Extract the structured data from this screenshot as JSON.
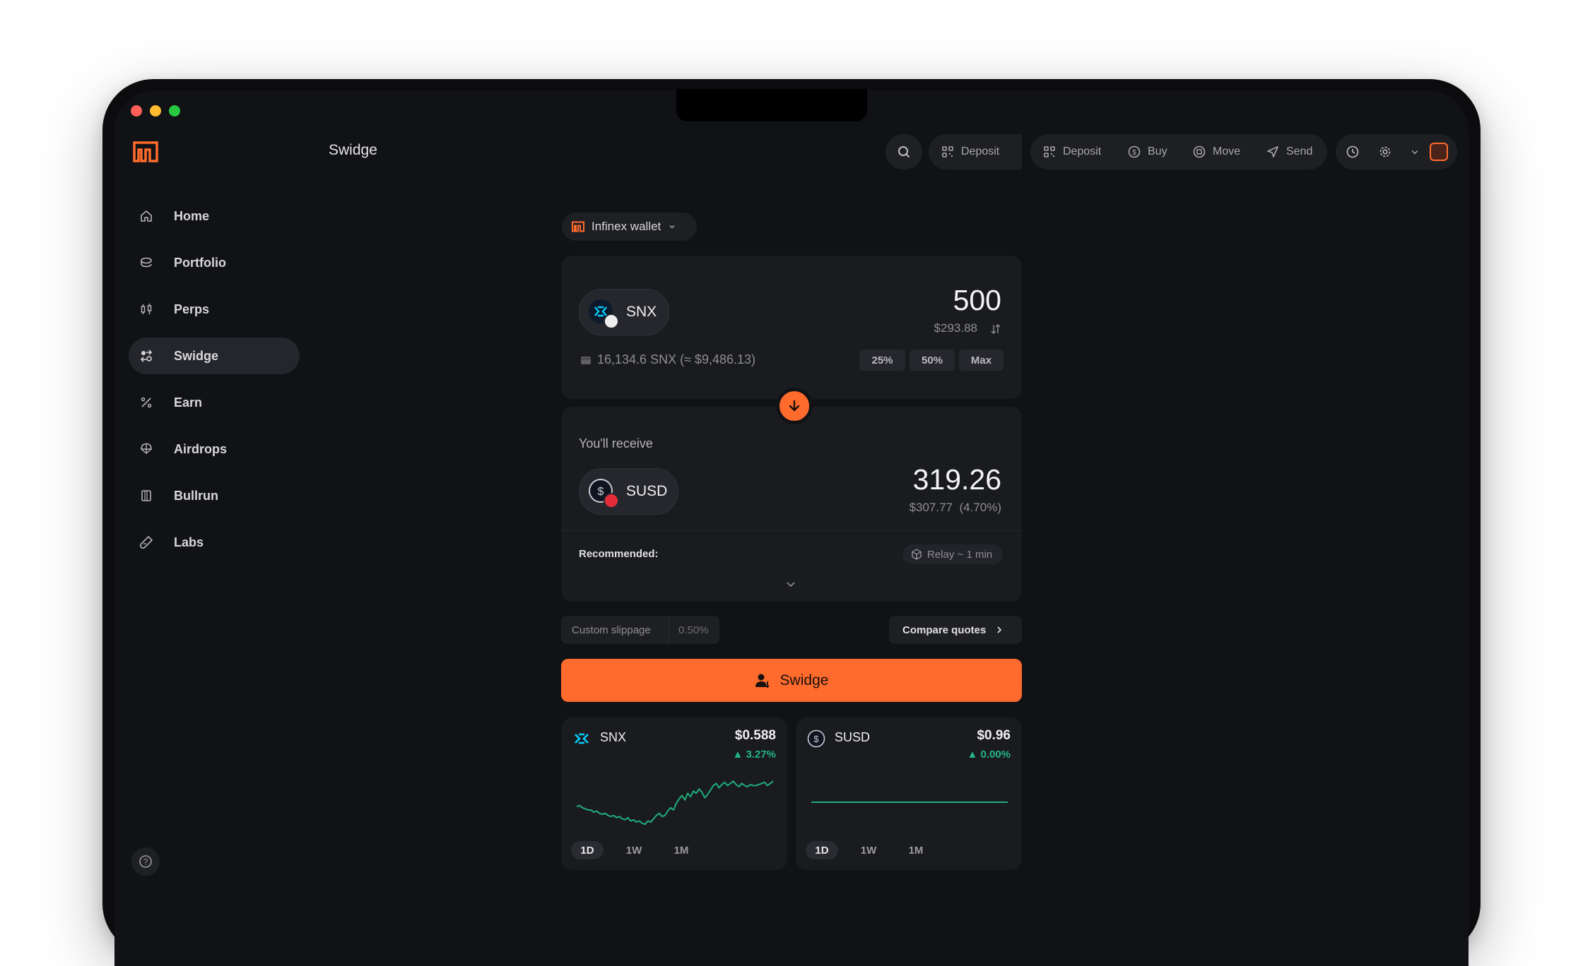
{
  "app": {
    "page_title": "Swidge",
    "brand_color": "#ff6b2c",
    "traffic_lights": [
      "#ff5f57",
      "#febc2e",
      "#28c840"
    ]
  },
  "toolbar": {
    "search_icon": "search-icon",
    "deposit_label_1": "Deposit",
    "deposit_label_2": "Deposit",
    "buy_label": "Buy",
    "move_label": "Move",
    "send_label": "Send"
  },
  "sidebar": {
    "items": [
      {
        "label": "Home",
        "icon": "home-icon"
      },
      {
        "label": "Portfolio",
        "icon": "coins-icon"
      },
      {
        "label": "Perps",
        "icon": "candles-icon"
      },
      {
        "label": "Swidge",
        "icon": "swidge-icon",
        "active": true
      },
      {
        "label": "Earn",
        "icon": "percent-icon"
      },
      {
        "label": "Airdrops",
        "icon": "parachute-icon"
      },
      {
        "label": "Bullrun",
        "icon": "book-icon"
      },
      {
        "label": "Labs",
        "icon": "flask-icon"
      }
    ]
  },
  "swap": {
    "wallet_label": "Infinex wallet",
    "from": {
      "symbol": "SNX",
      "amount": "500",
      "usd": "$293.88",
      "balance": "16,134.6 SNX (≈ $9,486.13)",
      "pct_buttons": [
        "25%",
        "50%",
        "Max"
      ]
    },
    "to": {
      "heading": "You'll receive",
      "symbol": "SUSD",
      "amount": "319.26",
      "usd": "$307.77",
      "pct": "(4.70%)"
    },
    "recommended_label": "Recommended:",
    "route": "Relay ~ 1 min",
    "slippage_label": "Custom slippage",
    "slippage_value": "0.50%",
    "compare_label": "Compare quotes",
    "cta_label": "Swidge"
  },
  "prices": [
    {
      "symbol": "SNX",
      "price": "$0.588",
      "change": "▲ 3.27%",
      "ranges": [
        "1D",
        "1W",
        "1M"
      ],
      "active_range": "1D"
    },
    {
      "symbol": "SUSD",
      "price": "$0.96",
      "change": "▲ 0.00%",
      "ranges": [
        "1D",
        "1W",
        "1M"
      ],
      "active_range": "1D"
    }
  ],
  "chart_data": [
    {
      "type": "line",
      "title": "SNX",
      "values": [
        0.569,
        0.57,
        0.568,
        0.567,
        0.566,
        0.566,
        0.564,
        0.565,
        0.563,
        0.562,
        0.563,
        0.561,
        0.56,
        0.561,
        0.559,
        0.56,
        0.558,
        0.557,
        0.559,
        0.556,
        0.557,
        0.555,
        0.556,
        0.554,
        0.553,
        0.556,
        0.555,
        0.558,
        0.561,
        0.563,
        0.56,
        0.561,
        0.565,
        0.568,
        0.566,
        0.572,
        0.576,
        0.579,
        0.575,
        0.581,
        0.578,
        0.583,
        0.581,
        0.585,
        0.582,
        0.577,
        0.58,
        0.584,
        0.588,
        0.59,
        0.586,
        0.589,
        0.591,
        0.588,
        0.59,
        0.592,
        0.589,
        0.587,
        0.59,
        0.588,
        0.587,
        0.589,
        0.588,
        0.588,
        0.589,
        0.59,
        0.591,
        0.588,
        0.59,
        0.592
      ],
      "color": "#1fae7a"
    },
    {
      "type": "line",
      "title": "SUSD",
      "values": [
        0.96,
        0.96,
        0.96,
        0.96,
        0.96,
        0.96,
        0.96,
        0.96,
        0.96,
        0.96,
        0.96,
        0.96
      ],
      "color": "#1fae7a"
    }
  ]
}
